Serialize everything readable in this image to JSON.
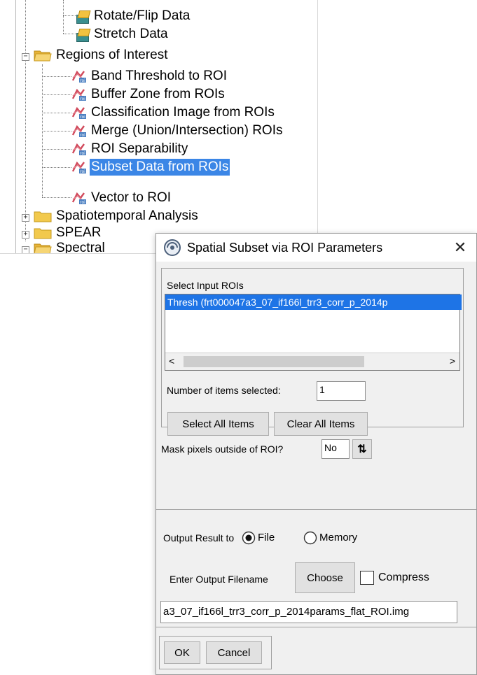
{
  "tree": {
    "items": [
      {
        "label": "Rotate/Flip Data",
        "icon": "tool-icon",
        "selected": false
      },
      {
        "label": "Stretch Data",
        "icon": "tool-icon",
        "selected": false
      },
      {
        "label": "Regions of Interest",
        "icon": "folder-icon",
        "selected": false
      },
      {
        "label": "Band Threshold to ROI",
        "icon": "roi-tool-icon",
        "selected": false
      },
      {
        "label": "Buffer Zone from ROIs",
        "icon": "roi-tool-icon",
        "selected": false
      },
      {
        "label": "Classification Image from ROIs",
        "icon": "roi-tool-icon",
        "selected": false
      },
      {
        "label": "Merge (Union/Intersection) ROIs",
        "icon": "roi-tool-icon",
        "selected": false
      },
      {
        "label": "ROI Separability",
        "icon": "roi-tool-icon",
        "selected": false
      },
      {
        "label": "Subset Data from ROIs",
        "icon": "roi-tool-icon",
        "selected": true
      },
      {
        "label": "Vector to ROI",
        "icon": "roi-tool-icon",
        "selected": false
      },
      {
        "label": "Spatiotemporal Analysis",
        "icon": "folder-icon",
        "selected": false
      },
      {
        "label": "SPEAR",
        "icon": "folder-icon",
        "selected": false
      },
      {
        "label": "Spectral",
        "icon": "folder-icon",
        "selected": false
      }
    ],
    "colors": {
      "selection": "#3b86e6",
      "folder": "#f2c94c"
    }
  },
  "dialog": {
    "title": "Spatial Subset via ROI Parameters",
    "close_glyph": "✕",
    "select_input_rois_label": "Select Input ROIs",
    "roi_list": [
      "Thresh (frt000047a3_07_if166l_trr3_corr_p_2014p"
    ],
    "scroll_left": "<",
    "scroll_right": ">",
    "items_selected_label": "Number of items selected:",
    "items_selected_value": "1",
    "select_all_button": "Select All Items",
    "clear_all_button": "Clear All Items",
    "mask_label": "Mask pixels outside of ROI?",
    "mask_value": "No",
    "toggle_glyph": "⇅",
    "output_result_label": "Output Result to",
    "output_file_option": "File",
    "output_memory_option": "Memory",
    "output_selected": "File",
    "enter_filename_label": "Enter Output Filename",
    "choose_button": "Choose",
    "compress_label": "Compress",
    "compress_checked": false,
    "filename_value": "a3_07_if166l_trr3_corr_p_2014params_flat_ROI.img",
    "ok_button": "OK",
    "cancel_button": "Cancel",
    "colors": {
      "selection": "#1e74e6"
    }
  }
}
